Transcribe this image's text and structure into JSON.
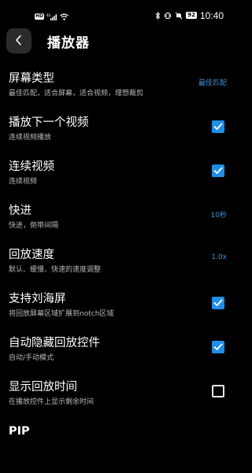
{
  "status_bar": {
    "hd_badge": "HD",
    "signal": "4G",
    "battery": "92",
    "time": "10:40"
  },
  "header": {
    "title": "播放器"
  },
  "settings": [
    {
      "title": "屏幕类型",
      "subtitle": "最佳匹配，适合屏幕，适合视频，理想裁剪",
      "value": "最佳匹配",
      "control": "value"
    },
    {
      "title": "播放下一个视频",
      "subtitle": "连续视频播放",
      "checked": true,
      "control": "checkbox"
    },
    {
      "title": "连续视频",
      "subtitle": "连续视频",
      "checked": true,
      "control": "checkbox"
    },
    {
      "title": "快进",
      "subtitle": "快进，倒带间隔",
      "value": "10秒",
      "control": "value"
    },
    {
      "title": "回放速度",
      "subtitle": "默认、缓慢、快速的速度调整",
      "value": "1.0x",
      "control": "value"
    },
    {
      "title": "支持刘海屏",
      "subtitle": "将回放屏幕区域扩展到notch区域",
      "checked": true,
      "control": "checkbox"
    },
    {
      "title": "自动隐藏回放控件",
      "subtitle": "自动/手动模式",
      "checked": true,
      "control": "checkbox"
    },
    {
      "title": "显示回放时间",
      "subtitle": "在播放控件上显示剩余时间",
      "checked": false,
      "control": "checkbox"
    }
  ],
  "pip": {
    "title": "PIP"
  },
  "colors": {
    "background": "#000000",
    "accent": "#1f8fe5",
    "value_text": "#3f8fe0",
    "subtitle": "#b8b8b8"
  }
}
